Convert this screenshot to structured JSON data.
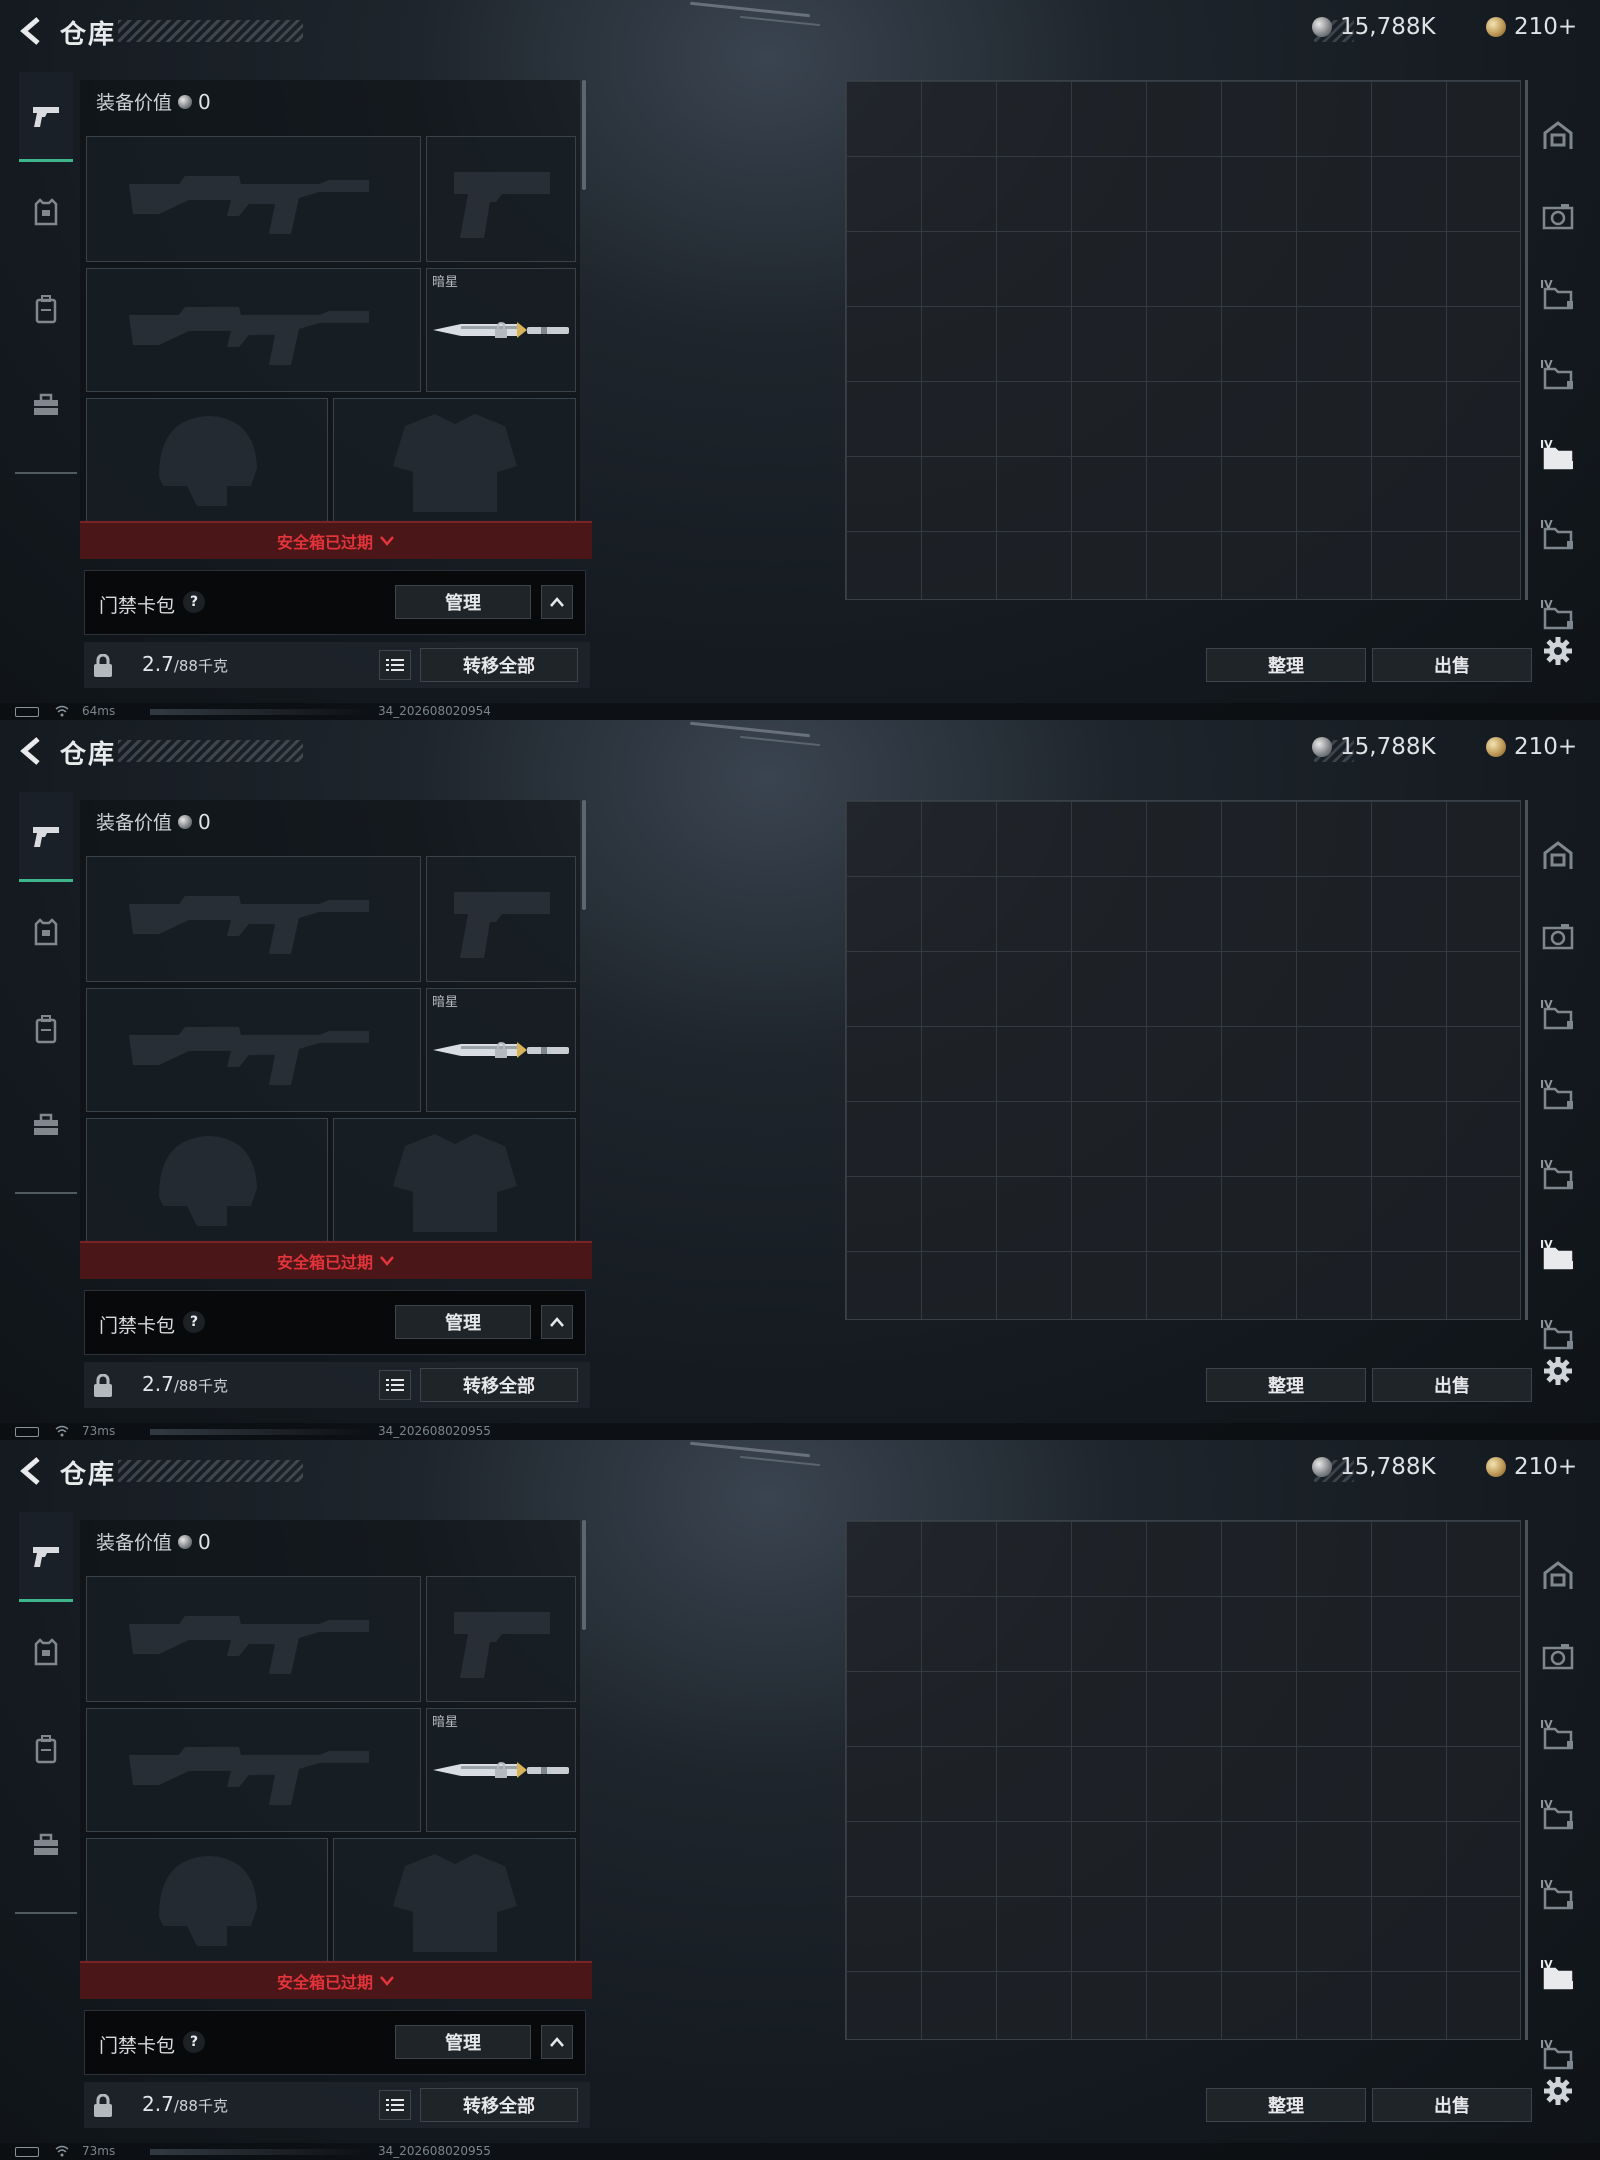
{
  "frames": [
    {
      "title": "仓库",
      "currency_silver": "15,788K",
      "currency_gold": "210+",
      "equip_value_label": "装备价值",
      "equip_value": "0",
      "knife_name": "暗星",
      "safebox_warning": "安全箱已过期",
      "keycard_label": "门禁卡包",
      "help_label": "?",
      "manage_label": "管理",
      "weight_value": "2.7",
      "weight_capacity": "/88千克",
      "transfer_all_label": "转移全部",
      "sort_label": "整理",
      "sell_label": "出售",
      "ping": "64ms",
      "build_id": "34_202608020954",
      "active_side_index": 4
    },
    {
      "title": "仓库",
      "currency_silver": "15,788K",
      "currency_gold": "210+",
      "equip_value_label": "装备价值",
      "equip_value": "0",
      "knife_name": "暗星",
      "safebox_warning": "安全箱已过期",
      "keycard_label": "门禁卡包",
      "help_label": "?",
      "manage_label": "管理",
      "weight_value": "2.7",
      "weight_capacity": "/88千克",
      "transfer_all_label": "转移全部",
      "sort_label": "整理",
      "sell_label": "出售",
      "ping": "73ms",
      "build_id": "34_202608020955",
      "active_side_index": 5
    },
    {
      "title": "仓库",
      "currency_silver": "15,788K",
      "currency_gold": "210+",
      "equip_value_label": "装备价值",
      "equip_value": "0",
      "knife_name": "暗星",
      "safebox_warning": "安全箱已过期",
      "keycard_label": "门禁卡包",
      "help_label": "?",
      "manage_label": "管理",
      "weight_value": "2.7",
      "weight_capacity": "/88千克",
      "transfer_all_label": "转移全部",
      "sort_label": "整理",
      "sell_label": "出售",
      "ping": "73ms",
      "build_id": "34_202608020955",
      "active_side_index": 5
    }
  ],
  "side_icons": [
    {
      "icon": "safe-room-icon",
      "roman": ""
    },
    {
      "icon": "stash-camera-icon",
      "roman": ""
    },
    {
      "icon": "stash-page-icon",
      "roman": "IV"
    },
    {
      "icon": "stash-page-icon",
      "roman": "IV"
    },
    {
      "icon": "stash-page-icon",
      "roman": "IV"
    },
    {
      "icon": "stash-page-icon",
      "roman": "IV"
    },
    {
      "icon": "stash-page-icon",
      "roman": "IV"
    }
  ],
  "categories": [
    "pistol-icon",
    "armor-icon",
    "backpack-icon",
    "toolbox-icon"
  ],
  "colors": {
    "accent": "#3fb58a",
    "warning": "#e2343a",
    "warning_bg": "#4a1618"
  }
}
